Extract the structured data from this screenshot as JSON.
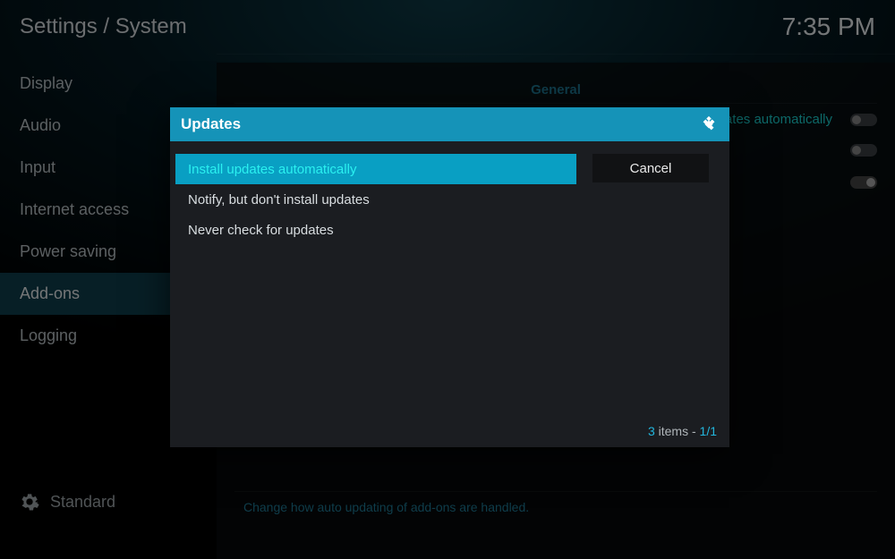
{
  "header": {
    "breadcrumb": "Settings / System",
    "clock": "7:35 PM"
  },
  "sidebar": {
    "items": [
      "Display",
      "Audio",
      "Input",
      "Internet access",
      "Power saving",
      "Add-ons",
      "Logging"
    ],
    "selected_index": 5,
    "level_label": "Standard"
  },
  "main": {
    "section": "General",
    "rows": [
      {
        "label": "updates automatically",
        "toggle": "off"
      },
      {
        "label": "",
        "toggle": "off"
      },
      {
        "label": "",
        "toggle": "on"
      }
    ],
    "help_text": "Change how auto updating of add-ons are handled."
  },
  "dialog": {
    "title": "Updates",
    "options": [
      "Install updates automatically",
      "Notify, but don't install updates",
      "Never check for updates"
    ],
    "selected_index": 0,
    "cancel_label": "Cancel",
    "footer_count": "3",
    "footer_word": " items - ",
    "footer_page": "1/1"
  }
}
